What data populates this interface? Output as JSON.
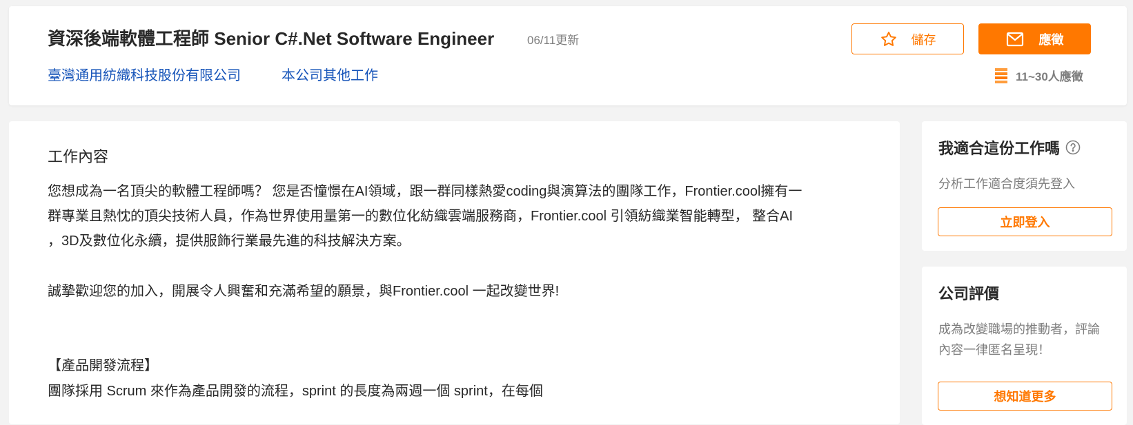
{
  "header": {
    "job_title": "資深後端軟體工程師 Senior C#.Net Software Engineer",
    "update_date": "06/11更新",
    "company_name": "臺灣通用紡織科技股份有限公司",
    "other_jobs": "本公司其他工作",
    "save_label": "儲存",
    "apply_label": "應徵",
    "applicants": "11~30人應徵",
    "accent_color": "#ff7800",
    "link_color": "#1654b9"
  },
  "job_content": {
    "title": "工作內容",
    "lines": [
      "您想成為一名頂尖的軟體工程師嗎？ 您是否憧憬在AI領域，跟一群同樣熱愛coding與演算法的團隊工作，Frontier.cool擁有一",
      "群專業且熱忱的頂尖技術人員，作為世界使用量第一的數位化紡織雲端服務商，Frontier.cool 引領紡織業智能轉型， 整合AI",
      "，3D及數位化永續，提供服飾行業最先進的科技解決方案。",
      "誠摯歡迎您的加入，開展令人興奮和充滿希望的願景，與Frontier.cool 一起改變世界!",
      "【產品開發流程】",
      "團隊採用 Scrum 來作為產品開發的流程，sprint 的長度為兩週一個 sprint，在每個"
    ]
  },
  "fit_card": {
    "title": "我適合這份工作嗎",
    "text": "分析工作適合度須先登入",
    "button": "立即登入"
  },
  "review_card": {
    "title": "公司評價",
    "text_line1": "成為改變職場的推動者，評論",
    "text_line2": "內容一律匿名呈現！",
    "button": "想知道更多"
  }
}
